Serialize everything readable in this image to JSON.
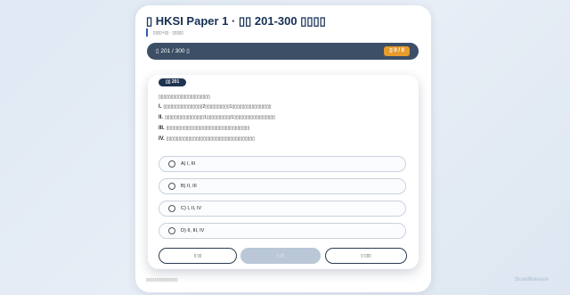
{
  "header": {
    "title": "▯ HKSI Paper 1 · ▯▯ 201-300 ▯▯▯▯",
    "subtitle": "▯▯▯▯+▯▯ · ▯▯▯▯▯"
  },
  "progress": {
    "label": "▯ 201 / 300 ▯",
    "score": "▯ 0 / 0"
  },
  "question": {
    "badge": "▯▯ 201",
    "stem": "▯▯▯▯▯▯▯▯▯▯▯▯▯▯▯▯▯▯▯▯▯",
    "statements": [
      {
        "num": "I.",
        "text": "▯▯▯▯▯▯▯▯▯▯▯▯▯▯▯▯2▯▯▯▯▯▯▯▯▯▯1▯▯▯▯▯▯▯▯▯▯▯▯▯▯▯▯"
      },
      {
        "num": "II.",
        "text": "▯▯▯▯▯▯▯▯▯▯▯▯▯▯▯▯1▯▯▯▯▯▯▯▯▯▯1▯▯▯▯▯▯▯▯▯▯▯▯▯▯▯▯▯"
      },
      {
        "num": "III.",
        "text": "▯▯▯▯▯▯▯▯▯▯▯▯▯▯▯▯▯▯▯▯▯▯▯▯▯▯▯▯▯▯▯▯▯▯"
      },
      {
        "num": "IV.",
        "text": "▯▯▯▯▯▯▯▯▯▯▯▯▯▯▯▯▯▯▯▯▯▯▯▯▯▯▯▯▯▯▯▯▯▯▯▯"
      }
    ],
    "options": [
      {
        "label": "A) I, III"
      },
      {
        "label": "B) II, III"
      },
      {
        "label": "C) I, II, IV"
      },
      {
        "label": "D) II, III, IV"
      }
    ]
  },
  "buttons": {
    "prev": "▯ ▯▯",
    "submit": "▯ ▯▯",
    "next": "▯ ▯▯▯"
  },
  "footer": {
    "text": "▯▯▯▯▯▯▯▯▯▯▯▯▯▯▯▯▯"
  },
  "watermark": "ScanMalware"
}
